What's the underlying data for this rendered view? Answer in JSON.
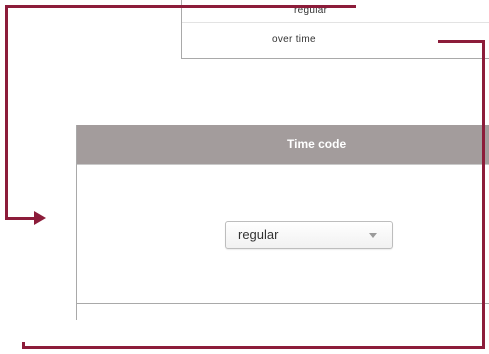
{
  "dropdown_list": {
    "options": [
      {
        "label": "regular"
      },
      {
        "label": "over time"
      }
    ]
  },
  "panel": {
    "header": "Time code",
    "select": {
      "value": "regular"
    }
  },
  "annotation": {
    "connector_color": "#8c1c3a"
  },
  "icons": {
    "select_arrow": "chevron-down-icon",
    "pointer": "arrow-right-icon"
  }
}
